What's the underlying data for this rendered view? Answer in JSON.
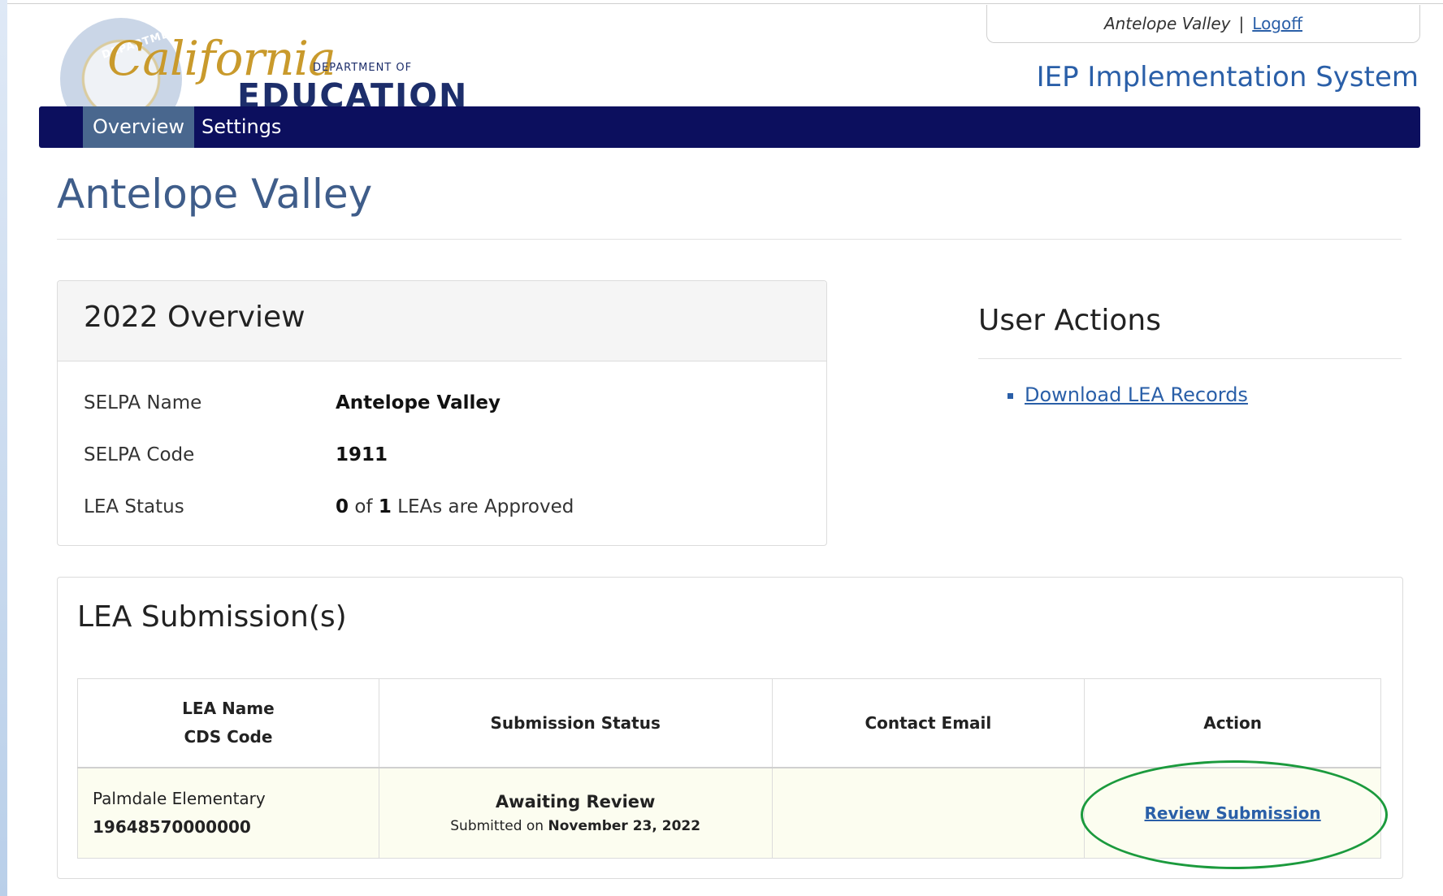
{
  "header": {
    "user_name": "Antelope Valley",
    "separator": "|",
    "logoff_label": "Logoff",
    "system_title": "IEP Implementation System",
    "logo": {
      "seal_text": "DEPARTMENT OF ED",
      "california": "California",
      "department_of": "DEPARTMENT OF",
      "education": "EDUCATION"
    }
  },
  "nav": {
    "items": [
      {
        "label": "Overview",
        "active": true
      },
      {
        "label": "Settings",
        "active": false
      }
    ]
  },
  "page": {
    "title": "Antelope Valley"
  },
  "overview": {
    "heading": "2022 Overview",
    "rows": [
      {
        "label": "SELPA Name",
        "value": "Antelope Valley"
      },
      {
        "label": "SELPA Code",
        "value": "1911"
      },
      {
        "label": "LEA Status",
        "approved": "0",
        "of_text": "of",
        "total": "1",
        "suffix": "LEAs are Approved"
      }
    ]
  },
  "user_actions": {
    "heading": "User Actions",
    "items": [
      {
        "label": "Download LEA Records"
      }
    ]
  },
  "lea_submissions": {
    "heading": "LEA Submission(s)",
    "columns": {
      "lea_name": "LEA Name",
      "cds_code": "CDS Code",
      "status": "Submission Status",
      "email": "Contact Email",
      "action": "Action"
    },
    "rows": [
      {
        "lea_name": "Palmdale Elementary",
        "cds_code": "19648570000000",
        "status": "Awaiting Review",
        "submitted_prefix": "Submitted on",
        "submitted_date": "November 23, 2022",
        "contact_email": "",
        "action_label": "Review Submission"
      }
    ]
  },
  "colors": {
    "navbar": "#0c0f5e",
    "nav_active": "#49678e",
    "link": "#2a5fa8",
    "title": "#3f5d8a",
    "highlight": "#1b9a3d"
  }
}
